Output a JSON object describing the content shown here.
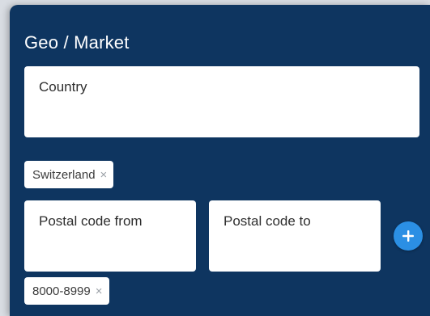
{
  "panel": {
    "title": "Geo / Market"
  },
  "country": {
    "label": "Country",
    "tags": [
      {
        "text": "Switzerland",
        "remove": "×"
      }
    ]
  },
  "postal": {
    "from_label": "Postal code from",
    "to_label": "Postal code to",
    "add_icon": "plus-icon",
    "tags": [
      {
        "text": "8000-8999",
        "remove": "×"
      }
    ]
  },
  "colors": {
    "panel_bg": "#0e3560",
    "accent": "#2b8fe4",
    "field_bg": "#ffffff"
  }
}
